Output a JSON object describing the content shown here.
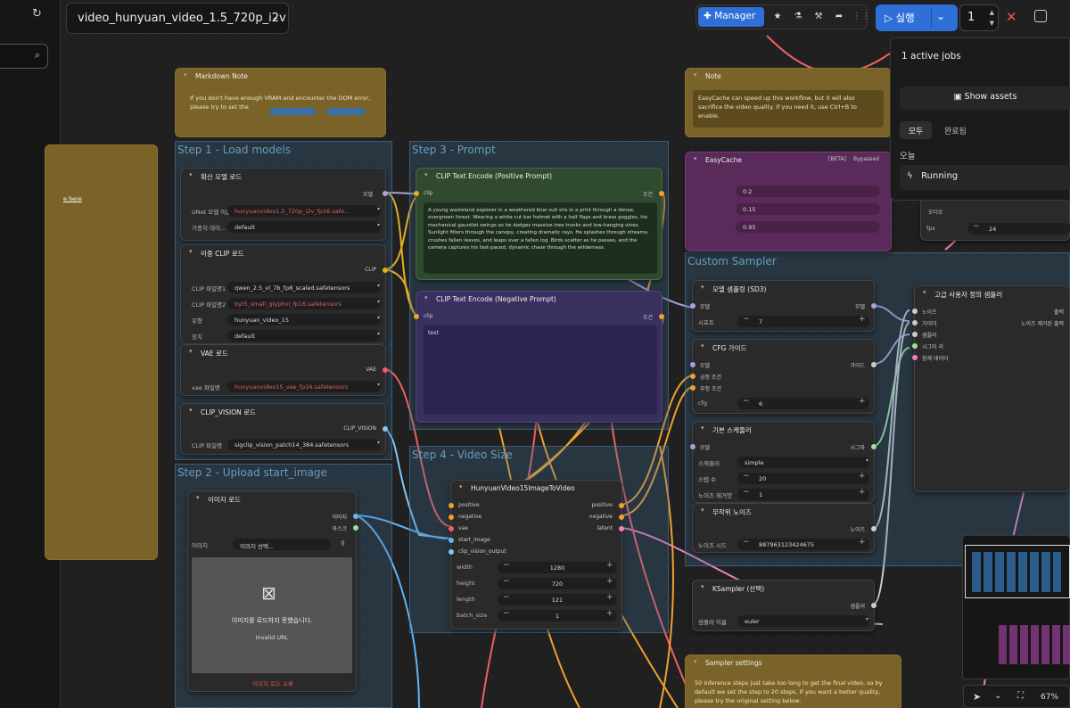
{
  "topbar": {
    "workflow_title": "video_hunyuan_video_1.5_720p_i2v",
    "manager_label": "Manager",
    "run_label": "실행",
    "queue_count": "1"
  },
  "jobs_panel": {
    "title": "1 active jobs",
    "show_assets": "Show assets",
    "tab_all": "모두",
    "tab_done": "완료됨",
    "section_today": "오늘",
    "job_status": "Running"
  },
  "groups": {
    "step1": "Step 1 - Load models",
    "step2": "Step 2 - Upload start_image",
    "step3": "Step 3 - Prompt",
    "step4": "Step 4 - Video Size",
    "custom_sampler": "Custom Sampler"
  },
  "markdown_note": {
    "title": "Markdown Note",
    "body": "If you don't have enough VRAM and encounter the OOM error, please try to set the"
  },
  "note": {
    "title": "Note",
    "body": "EasyCache can speed up this workflow, but it will also sacrifice the video quality. If you need it, use Ctrl+B to enable."
  },
  "left_note_link": "e here",
  "unet": {
    "title": "확산 모델 로드",
    "out": "모델",
    "unet_label": "UNet 모델 이름",
    "unet_value": "hunyuanvideo1.5_720p_i2v_fp16.safe...",
    "dtype_label": "가중치 데이...",
    "dtype_value": "default"
  },
  "dualclip": {
    "title": "이중 CLIP 로드",
    "out": "CLIP",
    "c1_label": "CLIP 파일명1",
    "c1_value": "qwen_2.5_vl_7b_fp8_scaled.safetensors",
    "c2_label": "CLIP 파일명2",
    "c2_value": "byt5_small_glyphxl_fp16.safetensors",
    "type_label": "유형",
    "type_value": "hunyuan_video_15",
    "dev_label": "장치",
    "dev_value": "default"
  },
  "vae": {
    "title": "VAE 로드",
    "out": "VAE",
    "label": "vae 파일명",
    "value": "hunyuanvideo15_vae_fp16.safetensors"
  },
  "clipvision": {
    "title": "CLIP_VISION 로드",
    "out": "CLIP_VISION",
    "label": "CLIP 파일명",
    "value": "sigclip_vision_patch14_384.safetensors"
  },
  "loadimage": {
    "title": "이미지 로드",
    "out1": "이미지",
    "out2": "마스크",
    "label": "이미지",
    "value": "이미지 선택...",
    "msg": "이미지를 로드하지 못했습니다.",
    "msg2": "Invalid URL",
    "err": "이미지 로드 오류"
  },
  "pos_prompt": {
    "title": "CLIP Text Encode (Positive Prompt)",
    "in": "clip",
    "out": "조건",
    "text": "A young wasteland explorer in a weathered blue suit sits in a print through a dense, overgrown forest. Wearing a white cut bar helmet with a half flaps and brass goggles, his mechanical gauntlet swings as he dodges massive tree trunks and low-hanging vines. Sunlight filters through the canopy, creating dramatic rays. He splashes through streams, crushes fallen leaves, and leaps over a fallen log. Birds scatter as he passes, and the camera captures his fast-paced, dynamic chase through the wilderness."
  },
  "neg_prompt": {
    "title": "CLIP Text Encode (Negative Prompt)",
    "in": "clip",
    "out": "조건",
    "text": "text"
  },
  "easycache": {
    "title": "EasyCache",
    "badge1": "[BETA]",
    "badge2": "Bypassed",
    "v1": "0.2",
    "v2": "0.15",
    "v3": "0.95"
  },
  "i2v": {
    "title": "HunyuanVideo15ImageToVideo",
    "in1": "positive",
    "in2": "negative",
    "in3": "vae",
    "in4": "start_image",
    "in5": "clip_vision_output",
    "out1": "positive",
    "out2": "negative",
    "out3": "latent",
    "w_label": "width",
    "w": "1280",
    "h_label": "height",
    "h": "720",
    "l_label": "length",
    "l": "121",
    "b_label": "batch_size",
    "b": "1"
  },
  "modelsampling": {
    "title": "모델 샘플링 (SD3)",
    "in": "모델",
    "out": "모델",
    "label": "시프트",
    "value": "7"
  },
  "cfg": {
    "title": "CFG 가이드",
    "in1": "모델",
    "in2": "긍정 조건",
    "in3": "부정 조건",
    "out": "가이드",
    "label": "cfg",
    "value": "6"
  },
  "sched": {
    "title": "기본 스케줄러",
    "in": "모델",
    "out": "시그마",
    "s_label": "스케줄러",
    "s": "simple",
    "st_label": "스텝 수",
    "st": "20",
    "dn_label": "노이즈 제거양",
    "dn": "1"
  },
  "noise": {
    "title": "무작위 노이즈",
    "out": "노이즈",
    "label": "노이즈 시드",
    "value": "887963123424675"
  },
  "ksampler": {
    "title": "KSampler (선택)",
    "out": "샘플러",
    "label": "샘플러 이름",
    "value": "euler"
  },
  "advsampler": {
    "title": "고급 사용자 정의 샘플러",
    "in1": "노이즈",
    "in2": "가이더",
    "in3": "샘플러",
    "in4": "시그마 리",
    "in5": "잠재 데이터",
    "out1": "출력",
    "out2": "노이즈 제거된 출력"
  },
  "savevideo": {
    "audio": "오디오",
    "fps_label": "fps",
    "fps": "24"
  },
  "sampler_note": {
    "title": "Sampler settings",
    "body": "50 inference steps just take too long to get the final video, so by default we set the step to 20 steps. If you want a better quality, please try the original setting below:"
  },
  "zoom": "67%"
}
